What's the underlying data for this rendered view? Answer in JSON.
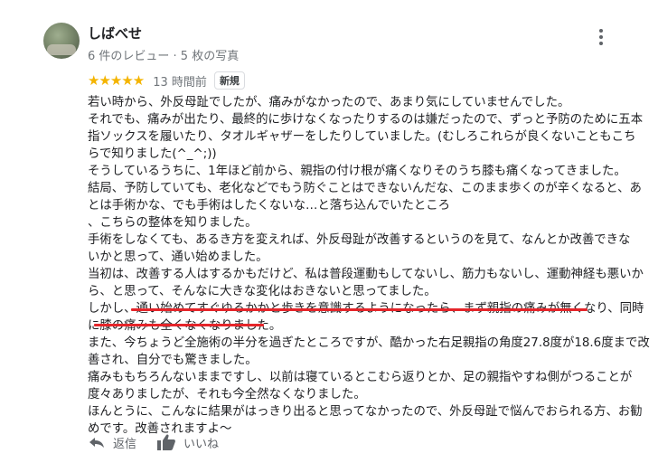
{
  "reviewer": {
    "name": "しばべせ",
    "meta": "6 件のレビュー · 5 枚の写真"
  },
  "rating": {
    "stars": "★★★★★",
    "value": 5,
    "time": "13 時間前",
    "badge": "新規"
  },
  "review_lines": [
    "若い時から、外反母趾でしたが、痛みがなかったので、あまり気にしていませんでした。",
    "それでも、痛みが出たり、最終的に歩けなくなったりするのは嫌だったので、ずっと予防のために五本",
    "指ソックスを履いたり、タオルギャザーをしたりしていました。(むしろこれらが良くないこともこち",
    "らで知りました(^_^;))",
    "そうしているうちに、1年ほど前から、親指の付け根が痛くなりそのうち膝も痛くなってきました。",
    "結局、予防していても、老化などでもう防ぐことはできないんだな、このまま歩くのが辛くなると、あ",
    "とは手術かな、でも手術はしたくないな…と落ち込んでいたところ",
    "、こちらの整体を知りました。",
    "手術をしなくても、あるき方を変えれば、外反母趾が改善するというのを見て、なんとか改善できな",
    "いかと思って、通い始めました。",
    "当初は、改善する人はするかもだけど、私は普段運動もしてないし、筋力もないし、運動神経も悪いか",
    "ら、と思って、そんなに大きな変化はおきないと思ってました。",
    "しかし、通い始めてすぐゆるかかと歩きを意識するようになったら、まず親指の痛みが無くなり、同時",
    "に膝の痛みも全くなくなりました。",
    "また、今ちょうど全施術の半分を過ぎたところですが、酷かった右足親指の角度27.8度が18.6度まで改",
    "善され、自分でも驚きました。",
    "痛みももちろんないままですし、以前は寝ているとこむら返りとか、足の親指やすね側がつることが",
    "度々ありましたが、それも今全然なくなりました。",
    "ほんとうに、こんなに結果がはっきり出ると思ってなかったので、外反母趾で悩んでおられる方、お勧",
    "めです。改善されますよ〜"
  ],
  "actions": {
    "reply_label": "返信",
    "like_label": "いいね"
  },
  "colors": {
    "star": "#f4b400",
    "underline": "#e5252a",
    "secondary_text": "#70757a"
  },
  "icons": [
    "more-vert-icon",
    "reply-icon",
    "thumb-up-icon"
  ]
}
